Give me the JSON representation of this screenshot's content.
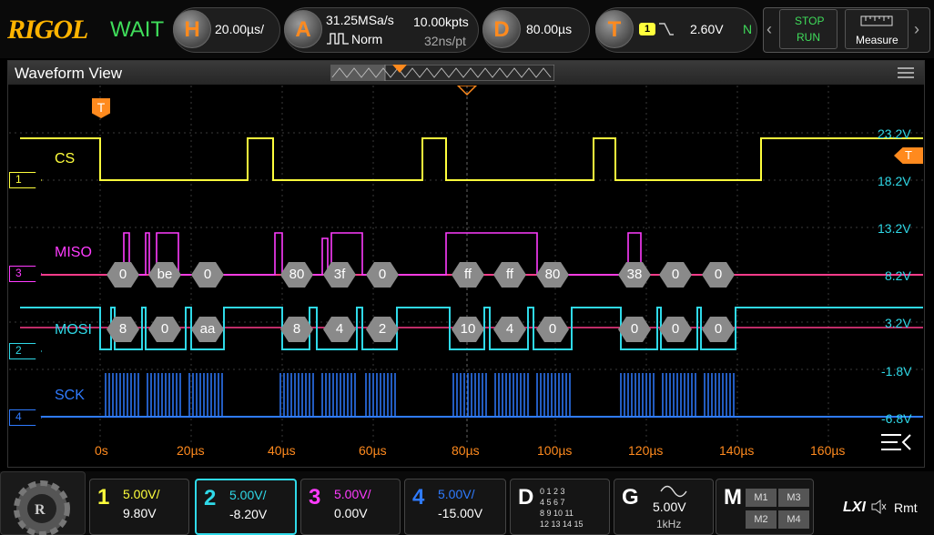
{
  "header": {
    "logo": "RIGOL",
    "status": "WAIT",
    "horizontal": {
      "key": "H",
      "timebase": "20.00µs/"
    },
    "acquire": {
      "key": "A",
      "sample_rate": "31.25MSa/s",
      "points": "10.00kpts",
      "mode": "Norm",
      "interval": "32ns/pt"
    },
    "delay": {
      "key": "D",
      "value": "80.00µs"
    },
    "trigger": {
      "key": "T",
      "source": "1",
      "level": "2.60V",
      "mode": "N"
    },
    "run_stop": {
      "stop": "STOP",
      "run": "RUN"
    },
    "measure": "Measure"
  },
  "waveform_view": {
    "title": "Waveform View",
    "trigger_marker": "T",
    "channel_labels": [
      {
        "text": "CS",
        "color": "#ffff3c"
      },
      {
        "text": "MISO",
        "color": "#ff3cff"
      },
      {
        "text": "MOSI",
        "color": "#2fd9e8"
      },
      {
        "text": "SCK",
        "color": "#2f7bff"
      }
    ],
    "channel_markers": [
      "1",
      "3",
      "2",
      "4"
    ],
    "right_scale": [
      "23.2V",
      "18.2V",
      "13.2V",
      "8.2V",
      "3.2V",
      "-1.8V",
      "-6.8V"
    ],
    "right_trigger": "T",
    "time_ticks": [
      "0s",
      "20µs",
      "40µs",
      "60µs",
      "80µs",
      "100µs",
      "120µs",
      "140µs",
      "160µs"
    ],
    "miso_bytes": [
      "0",
      "be",
      "0",
      "80",
      "3f",
      "0",
      "ff",
      "ff",
      "80",
      "38",
      "0",
      "0"
    ],
    "mosi_bytes": [
      "8",
      "0",
      "aa",
      "8",
      "4",
      "2",
      "10",
      "4",
      "0",
      "0",
      "0",
      "0"
    ]
  },
  "channels": [
    {
      "num": "1",
      "scale": "5.00V/",
      "offset": "9.80V",
      "color": "#ffff3c"
    },
    {
      "num": "2",
      "scale": "5.00V/",
      "offset": "-8.20V",
      "color": "#2fd9e8"
    },
    {
      "num": "3",
      "scale": "5.00V/",
      "offset": "0.00V",
      "color": "#ff3cff"
    },
    {
      "num": "4",
      "scale": "5.00V/",
      "offset": "-15.00V",
      "color": "#2f7bff"
    }
  ],
  "digital": {
    "key": "D",
    "rows": [
      "0 1 2 3",
      "4 5 6 7",
      "8 9 10 11",
      "12 13 14 15"
    ]
  },
  "generator": {
    "key": "G",
    "amplitude": "5.00V",
    "freq": "1kHz"
  },
  "math": {
    "key": "M",
    "items": [
      "M1",
      "M3",
      "M2",
      "M4"
    ]
  },
  "footer": {
    "lxi": "LXI",
    "remote": "Rmt"
  }
}
